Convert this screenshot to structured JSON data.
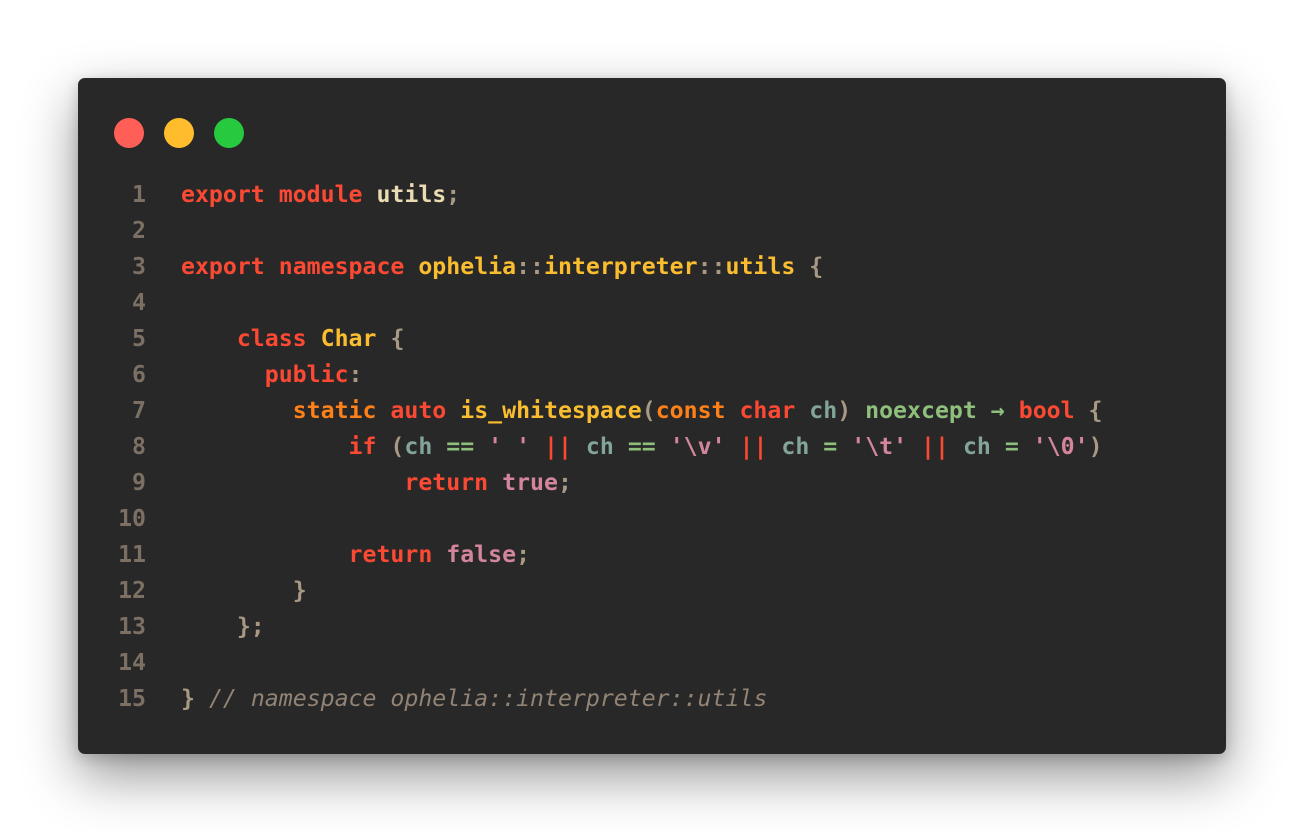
{
  "window": {
    "controls": [
      "close",
      "minimize",
      "maximize"
    ],
    "colors": {
      "background": "#282828",
      "close": "#ff5f56",
      "minimize": "#ffbd2e",
      "maximize": "#27c93f"
    }
  },
  "code": {
    "lines": [
      {
        "number": "1",
        "tokens": [
          {
            "t": "export",
            "c": "kw"
          },
          {
            "t": " "
          },
          {
            "t": "module",
            "c": "kw"
          },
          {
            "t": " "
          },
          {
            "t": "utils",
            "c": "id"
          },
          {
            "t": ";",
            "c": "pn"
          }
        ]
      },
      {
        "number": "2",
        "tokens": []
      },
      {
        "number": "3",
        "tokens": [
          {
            "t": "export",
            "c": "kw"
          },
          {
            "t": " "
          },
          {
            "t": "namespace",
            "c": "kw"
          },
          {
            "t": " "
          },
          {
            "t": "ophelia",
            "c": "tp"
          },
          {
            "t": "::",
            "c": "pn"
          },
          {
            "t": "interpreter",
            "c": "tp"
          },
          {
            "t": "::",
            "c": "pn"
          },
          {
            "t": "utils",
            "c": "tp"
          },
          {
            "t": " "
          },
          {
            "t": "{",
            "c": "pn"
          }
        ]
      },
      {
        "number": "4",
        "tokens": []
      },
      {
        "number": "5",
        "tokens": [
          {
            "t": "    "
          },
          {
            "t": "class",
            "c": "kw"
          },
          {
            "t": " "
          },
          {
            "t": "Char",
            "c": "tp"
          },
          {
            "t": " "
          },
          {
            "t": "{",
            "c": "pn"
          }
        ]
      },
      {
        "number": "6",
        "tokens": [
          {
            "t": "      "
          },
          {
            "t": "public",
            "c": "kw"
          },
          {
            "t": ":",
            "c": "pn"
          }
        ]
      },
      {
        "number": "7",
        "tokens": [
          {
            "t": "        "
          },
          {
            "t": "static",
            "c": "kw2"
          },
          {
            "t": " "
          },
          {
            "t": "auto",
            "c": "kw"
          },
          {
            "t": " "
          },
          {
            "t": "is_whitespace",
            "c": "fn"
          },
          {
            "t": "(",
            "c": "pn"
          },
          {
            "t": "const",
            "c": "kw2"
          },
          {
            "t": " "
          },
          {
            "t": "char",
            "c": "kw"
          },
          {
            "t": " "
          },
          {
            "t": "ch",
            "c": "var"
          },
          {
            "t": ")",
            "c": "pn"
          },
          {
            "t": " "
          },
          {
            "t": "noexcept",
            "c": "ne"
          },
          {
            "t": " "
          },
          {
            "t": "→",
            "c": "ne"
          },
          {
            "t": " "
          },
          {
            "t": "bool",
            "c": "kw"
          },
          {
            "t": " "
          },
          {
            "t": "{",
            "c": "pn"
          }
        ]
      },
      {
        "number": "8",
        "tokens": [
          {
            "t": "            "
          },
          {
            "t": "if",
            "c": "kw"
          },
          {
            "t": " "
          },
          {
            "t": "(",
            "c": "pn"
          },
          {
            "t": "ch",
            "c": "var"
          },
          {
            "t": " "
          },
          {
            "t": "==",
            "c": "ne"
          },
          {
            "t": " "
          },
          {
            "t": "' '",
            "c": "str"
          },
          {
            "t": " "
          },
          {
            "t": "||",
            "c": "kw"
          },
          {
            "t": " "
          },
          {
            "t": "ch",
            "c": "var"
          },
          {
            "t": " "
          },
          {
            "t": "==",
            "c": "ne"
          },
          {
            "t": " "
          },
          {
            "t": "'\\v'",
            "c": "str"
          },
          {
            "t": " "
          },
          {
            "t": "||",
            "c": "kw"
          },
          {
            "t": " "
          },
          {
            "t": "ch",
            "c": "var"
          },
          {
            "t": " "
          },
          {
            "t": "=",
            "c": "ne"
          },
          {
            "t": " "
          },
          {
            "t": "'\\t'",
            "c": "str"
          },
          {
            "t": " "
          },
          {
            "t": "||",
            "c": "kw"
          },
          {
            "t": " "
          },
          {
            "t": "ch",
            "c": "var"
          },
          {
            "t": " "
          },
          {
            "t": "=",
            "c": "ne"
          },
          {
            "t": " "
          },
          {
            "t": "'\\0'",
            "c": "str"
          },
          {
            "t": ")",
            "c": "pn"
          }
        ]
      },
      {
        "number": "9",
        "tokens": [
          {
            "t": "                "
          },
          {
            "t": "return",
            "c": "kw"
          },
          {
            "t": " "
          },
          {
            "t": "true",
            "c": "bool"
          },
          {
            "t": ";",
            "c": "pn"
          }
        ]
      },
      {
        "number": "10",
        "tokens": []
      },
      {
        "number": "11",
        "tokens": [
          {
            "t": "            "
          },
          {
            "t": "return",
            "c": "kw"
          },
          {
            "t": " "
          },
          {
            "t": "false",
            "c": "bool"
          },
          {
            "t": ";",
            "c": "pn"
          }
        ]
      },
      {
        "number": "12",
        "tokens": [
          {
            "t": "        "
          },
          {
            "t": "}",
            "c": "pn"
          }
        ]
      },
      {
        "number": "13",
        "tokens": [
          {
            "t": "    "
          },
          {
            "t": "};",
            "c": "pn"
          }
        ]
      },
      {
        "number": "14",
        "tokens": []
      },
      {
        "number": "15",
        "tokens": [
          {
            "t": "}",
            "c": "pn"
          },
          {
            "t": " "
          },
          {
            "t": "// namespace ophelia::interpreter::utils",
            "c": "cm"
          }
        ]
      }
    ]
  }
}
